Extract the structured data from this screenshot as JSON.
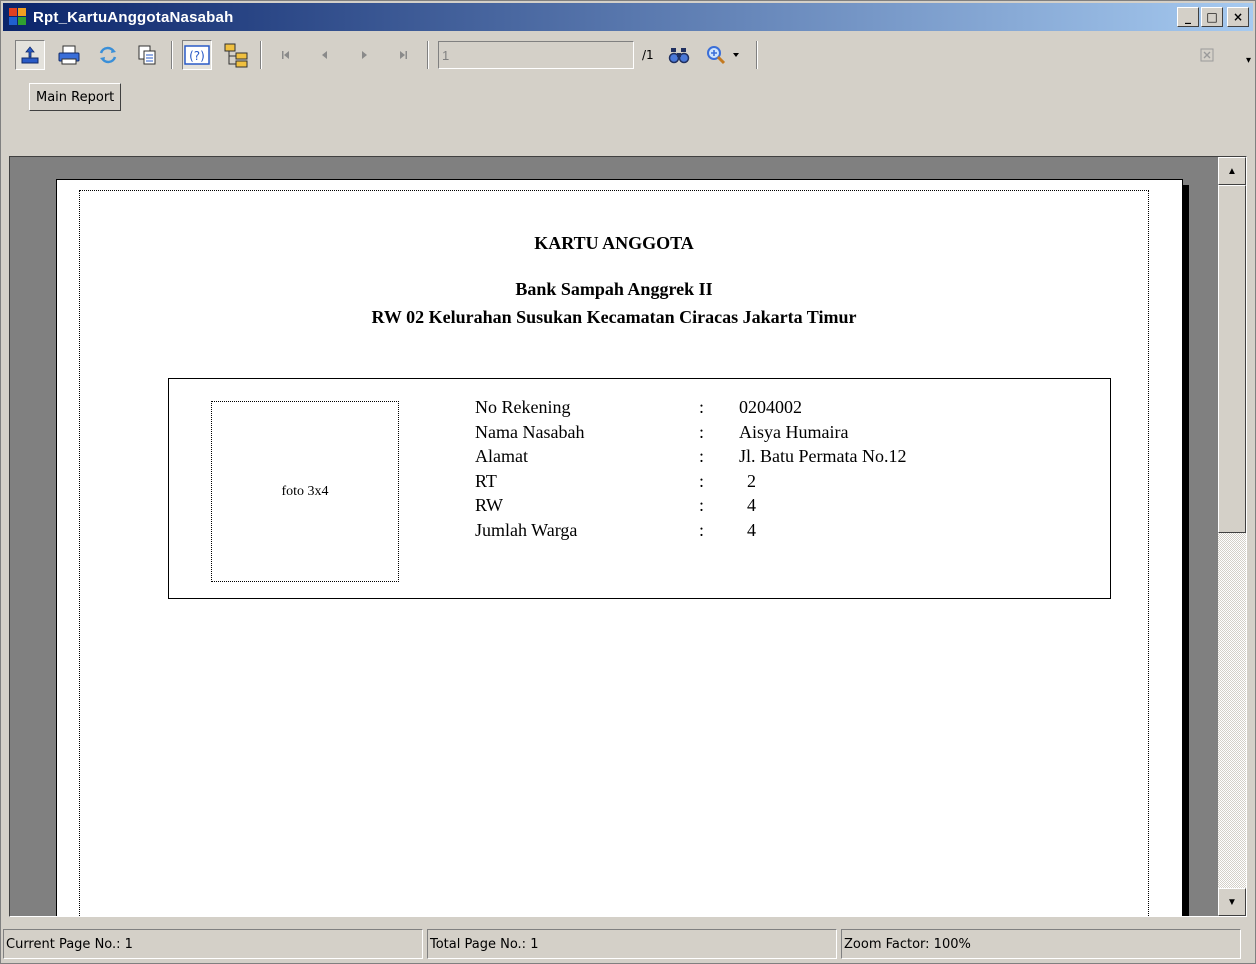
{
  "window": {
    "title": "Rpt_KartuAnggotaNasabah",
    "minimize": "_",
    "maximize": "□",
    "close": "×"
  },
  "toolbar": {
    "page_value": "1",
    "page_total": "/1",
    "icons": [
      "export-icon",
      "print-icon",
      "refresh-icon",
      "copy-icon",
      "help-icon",
      "group-tree-icon",
      "first-page-icon",
      "prev-page-icon",
      "next-page-icon",
      "last-page-icon",
      "search-icon",
      "zoom-icon",
      "close-icon"
    ]
  },
  "tabs": [
    {
      "label": "Main Report"
    }
  ],
  "report": {
    "title": "KARTU ANGGOTA",
    "org_name": "Bank Sampah Anggrek II",
    "org_address": "RW 02 Kelurahan Susukan Kecamatan Ciracas Jakarta Timur",
    "photo_label": "foto 3x4",
    "fields": [
      {
        "label": "No Rekening",
        "colon": ":",
        "value": "0204002"
      },
      {
        "label": "Nama Nasabah",
        "colon": ":",
        "value": "Aisya Humaira"
      },
      {
        "label": "Alamat",
        "colon": ":",
        "value": "Jl. Batu Permata No.12"
      },
      {
        "label": "RT",
        "colon": ":",
        "value": "2"
      },
      {
        "label": "RW",
        "colon": ":",
        "value": "4"
      },
      {
        "label": "Jumlah Warga",
        "colon": ":",
        "value": "4"
      }
    ]
  },
  "status": {
    "current_page": "Current Page No.: 1",
    "total_page": "Total Page No.: 1",
    "zoom": "Zoom Factor: 100%"
  }
}
